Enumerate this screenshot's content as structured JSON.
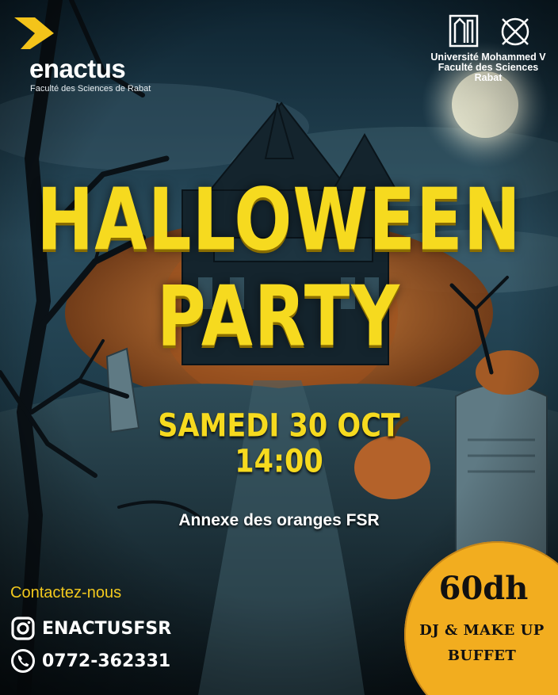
{
  "brand": {
    "name": "enactus",
    "subtitle": "Faculté des Sciences de Rabat",
    "accent": "#f4c41a"
  },
  "university": {
    "lines": [
      "Université Mohammed V",
      "Faculté des Sciences",
      "Rabat"
    ]
  },
  "event": {
    "title_line_1": "HALLOWEEN",
    "title_line_2": "PARTY",
    "date": "SAMEDI 30 OCT",
    "time": "14:00",
    "venue": "Annexe des oranges FSR",
    "title_color": "#f6da1f"
  },
  "contact": {
    "heading": "Contactez-nous",
    "instagram": {
      "icon": "instagram-icon",
      "handle": "ENACTUSFSR"
    },
    "phone": {
      "icon": "phone-icon",
      "number": "0772-362331"
    }
  },
  "price": {
    "amount": "60dh",
    "line_1": "DJ & MAKE UP",
    "line_2": "BUFFET",
    "badge_color": "#f2ad1f"
  }
}
